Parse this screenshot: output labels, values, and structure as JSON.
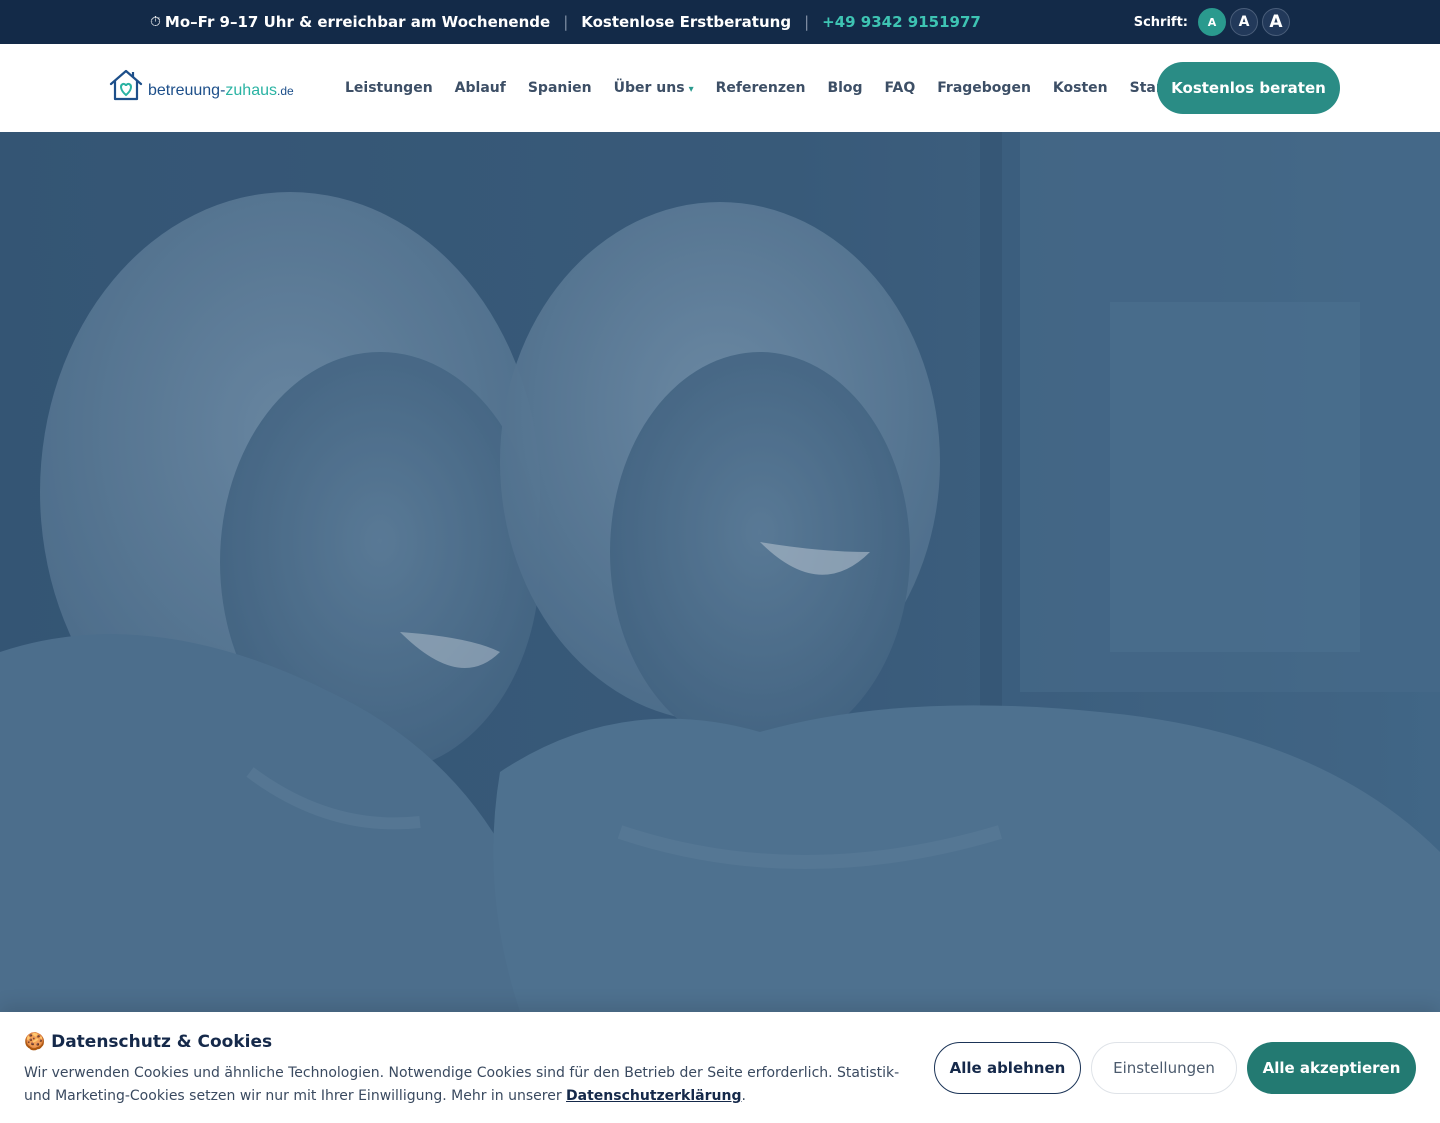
{
  "topbar": {
    "clock_glyph": "⏱",
    "hours": "Mo–Fr 9–17 Uhr & erreichbar am Wochenende",
    "separator": "|",
    "consultation": "Kostenlose Erstberatung",
    "phone": "+49 9342 9151977",
    "font_label": "Schrift:",
    "font_sizes": [
      "A",
      "A",
      "A"
    ]
  },
  "logo": {
    "part1": "betreuung-",
    "part2": "zuhaus",
    "tld": ".de"
  },
  "nav": {
    "items": [
      "Leistungen",
      "Ablauf",
      "Spanien",
      "Über uns",
      "Referenzen",
      "Blog",
      "FAQ",
      "Fragebogen",
      "Kosten",
      "Standorte"
    ],
    "caret": "▾"
  },
  "cta": {
    "label": "Kostenlos beraten"
  },
  "cookie": {
    "icon": "🍪",
    "title": "Datenschutz & Cookies",
    "text": "Wir verwenden Cookies und ähnliche Technologien. Notwendige Cookies sind für den Betrieb der Seite erforderlich. Statistik- und Marketing-Cookies setzen wir nur mit Ihrer Einwilligung. Mehr in unserer ",
    "link": "Datenschutzerklärung",
    "text_end": ".",
    "reject": "Alle ablehnen",
    "settings": "Einstellungen",
    "accept": "Alle akzeptieren"
  },
  "colors": {
    "topbar_bg": "#132a48",
    "accent": "#2a9a8e",
    "phone": "#3ec4b3",
    "hero_overlay": "#3f6380",
    "accept_button": "#237a72"
  }
}
